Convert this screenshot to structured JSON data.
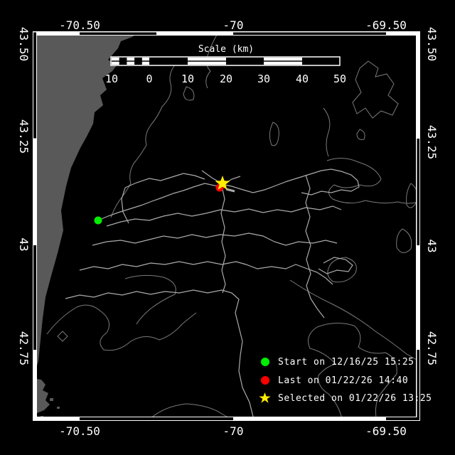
{
  "axes": {
    "top": [
      "-70.50",
      "-70",
      "-69.50"
    ],
    "bottom": [
      "-70.50",
      "-70",
      "-69.50"
    ],
    "left": [
      "43.50",
      "43.25",
      "43",
      "42.75"
    ],
    "right": [
      "43.50",
      "43.25",
      "43",
      "42.75"
    ]
  },
  "scalebar": {
    "title": "Scale (km)",
    "tick_labels": [
      "10",
      "0",
      "10",
      "20",
      "30",
      "40",
      "50"
    ]
  },
  "legend": {
    "items": [
      {
        "marker": "circle",
        "color": "#00ee00",
        "label": "Start on 12/16/25 15:25"
      },
      {
        "marker": "circle",
        "color": "#ff0000",
        "label": "Last on 01/22/26 14:40"
      },
      {
        "marker": "star",
        "color": "#ffee00",
        "label": "Selected on 01/22/26 13:25"
      }
    ]
  },
  "markers": {
    "start": {
      "shape": "circle",
      "color": "#00ee00"
    },
    "last": {
      "shape": "circle",
      "color": "#ff0000"
    },
    "selected": {
      "shape": "star",
      "color": "#ffee00"
    }
  },
  "colors": {
    "background": "#000000",
    "land": "#595959",
    "contour": "#7a7a7a",
    "track": "#ababab",
    "frame": "#ffffff",
    "text": "#ffffff"
  }
}
